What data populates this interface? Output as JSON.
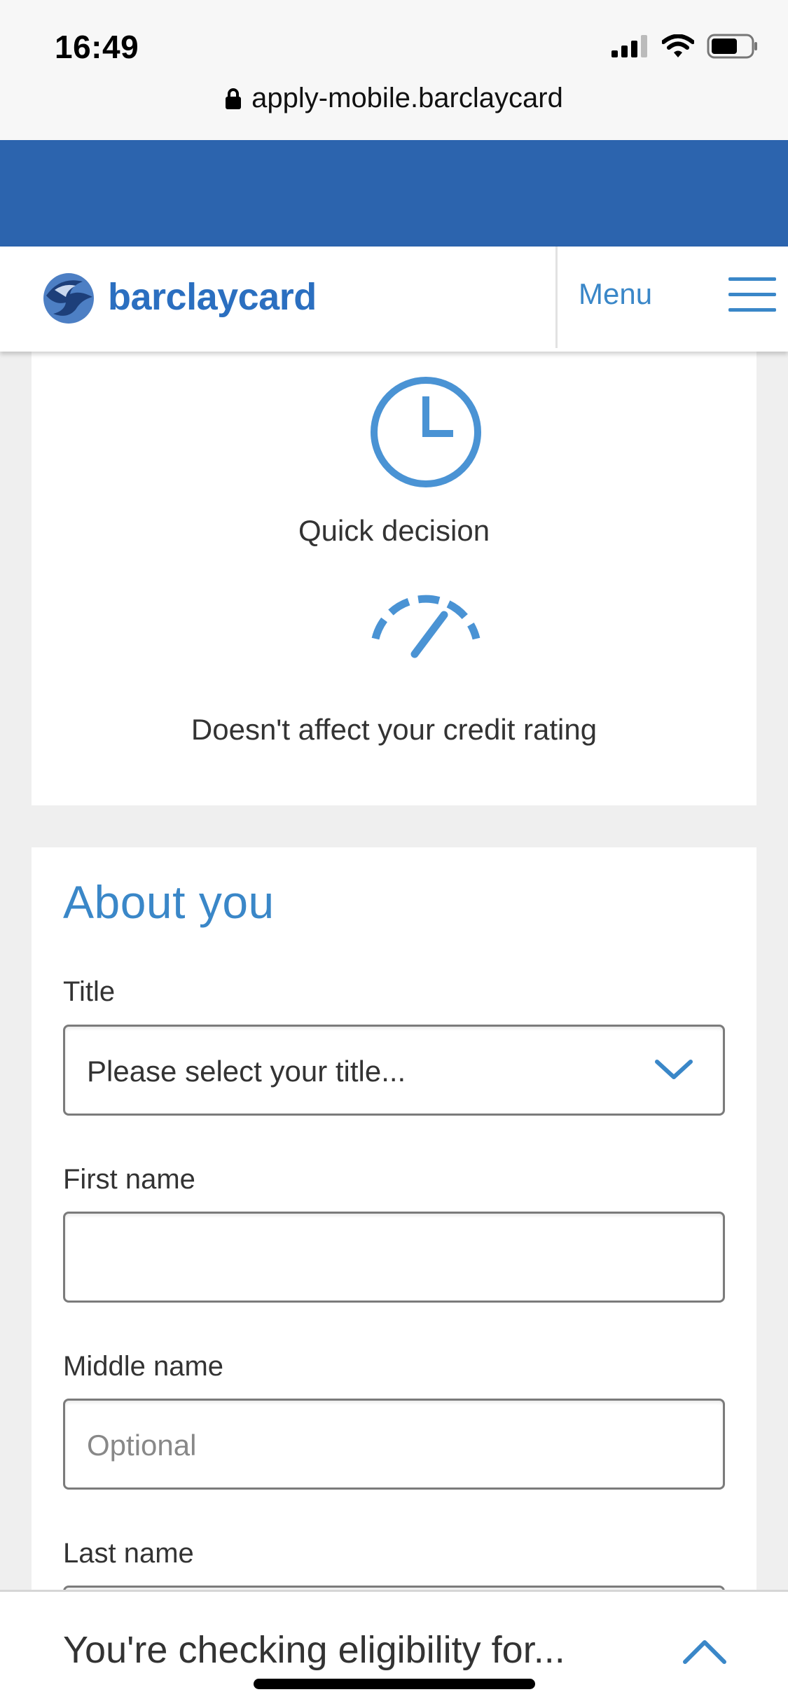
{
  "status_bar": {
    "time": "16:49",
    "icons": [
      "signal-icon",
      "wifi-icon",
      "battery-icon"
    ]
  },
  "browser": {
    "url": "apply-mobile.barclaycard",
    "lock_icon": "lock-icon"
  },
  "header": {
    "logo_text": "barclaycard",
    "menu_label": "Menu",
    "menu_icon": "hamburger-icon"
  },
  "features": [
    {
      "icon": "clock-icon",
      "label": "Quick decision"
    },
    {
      "icon": "gauge-icon",
      "label": "Doesn't affect your credit rating"
    }
  ],
  "form": {
    "title": "About you",
    "fields": [
      {
        "label": "Title",
        "type": "select",
        "value": "Please select your title..."
      },
      {
        "label": "First name",
        "type": "text",
        "value": ""
      },
      {
        "label": "Middle name",
        "type": "text",
        "placeholder": "Optional"
      },
      {
        "label": "Last name",
        "type": "text",
        "value": ""
      }
    ]
  },
  "bottom_bar": {
    "text": "You're checking eligibility for..."
  },
  "colors": {
    "brand_blue": "#2c64ae",
    "accent_blue": "#3a87c8",
    "background": "#efefef"
  }
}
